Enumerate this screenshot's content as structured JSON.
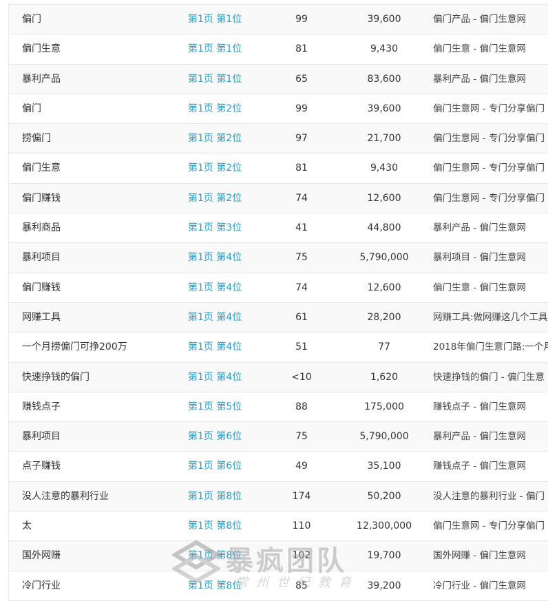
{
  "rows": [
    {
      "keyword": "偏门",
      "rank": "第1页 第1位",
      "index": "99",
      "volume": "39,600",
      "title": "偏门产品 - 偏门生意网"
    },
    {
      "keyword": "偏门生意",
      "rank": "第1页 第1位",
      "index": "81",
      "volume": "9,430",
      "title": "偏门生意 - 偏门生意网"
    },
    {
      "keyword": "暴利产品",
      "rank": "第1页 第1位",
      "index": "65",
      "volume": "83,600",
      "title": "暴利产品 - 偏门生意网"
    },
    {
      "keyword": "偏门",
      "rank": "第1页 第2位",
      "index": "99",
      "volume": "39,600",
      "title": "偏门生意网 - 专门分享偏门"
    },
    {
      "keyword": "捞偏门",
      "rank": "第1页 第2位",
      "index": "97",
      "volume": "21,700",
      "title": "偏门生意网 - 专门分享偏门"
    },
    {
      "keyword": "偏门生意",
      "rank": "第1页 第2位",
      "index": "81",
      "volume": "9,430",
      "title": "偏门生意网 - 专门分享偏门"
    },
    {
      "keyword": "偏门赚钱",
      "rank": "第1页 第2位",
      "index": "74",
      "volume": "12,600",
      "title": "偏门生意网 - 专门分享偏门"
    },
    {
      "keyword": "暴利商品",
      "rank": "第1页 第3位",
      "index": "41",
      "volume": "44,800",
      "title": "暴利产品 - 偏门生意网"
    },
    {
      "keyword": "暴利项目",
      "rank": "第1页 第4位",
      "index": "75",
      "volume": "5,790,000",
      "title": "暴利项目 - 偏门生意网"
    },
    {
      "keyword": "偏门赚钱",
      "rank": "第1页 第4位",
      "index": "74",
      "volume": "12,600",
      "title": "偏门生意 - 偏门生意网"
    },
    {
      "keyword": "网赚工具",
      "rank": "第1页 第4位",
      "index": "61",
      "volume": "28,200",
      "title": "网赚工具:做网赚这几个工具"
    },
    {
      "keyword": "一个月捞偏门可挣200万",
      "rank": "第1页 第4位",
      "index": "51",
      "volume": "77",
      "title": "2018年偏门生意门路:一个月"
    },
    {
      "keyword": "快速挣钱的偏门",
      "rank": "第1页 第4位",
      "index": "<10",
      "volume": "1,620",
      "title": "快速挣钱的偏门 - 偏门生意"
    },
    {
      "keyword": "赚钱点子",
      "rank": "第1页 第5位",
      "index": "88",
      "volume": "175,000",
      "title": "赚钱点子 - 偏门生意网"
    },
    {
      "keyword": "暴利项目",
      "rank": "第1页 第6位",
      "index": "75",
      "volume": "5,790,000",
      "title": "暴利产品 - 偏门生意网"
    },
    {
      "keyword": "点子赚钱",
      "rank": "第1页 第6位",
      "index": "49",
      "volume": "35,100",
      "title": "赚钱点子 - 偏门生意网"
    },
    {
      "keyword": "没人注意的暴利行业",
      "rank": "第1页 第8位",
      "index": "174",
      "volume": "50,200",
      "title": "没人注意的暴利行业 - 偏门"
    },
    {
      "keyword": "太",
      "rank": "第1页 第8位",
      "index": "110",
      "volume": "12,300,000",
      "title": "偏门生意网 - 专门分享偏门"
    },
    {
      "keyword": "国外网赚",
      "rank": "第1页 第8位",
      "index": "102",
      "volume": "19,700",
      "title": "国外网赚 - 偏门生意网"
    },
    {
      "keyword": "冷门行业",
      "rank": "第1页 第8位",
      "index": "85",
      "volume": "39,200",
      "title": "冷门行业 - 偏门生意网"
    }
  ],
  "watermark": {
    "main": "暴疯团队",
    "sub": "常州世纪教育"
  },
  "colors": {
    "rank_link": "#2b9bc6",
    "row_border": "#e8e8e8",
    "alt_row": "#f9f9f9"
  }
}
